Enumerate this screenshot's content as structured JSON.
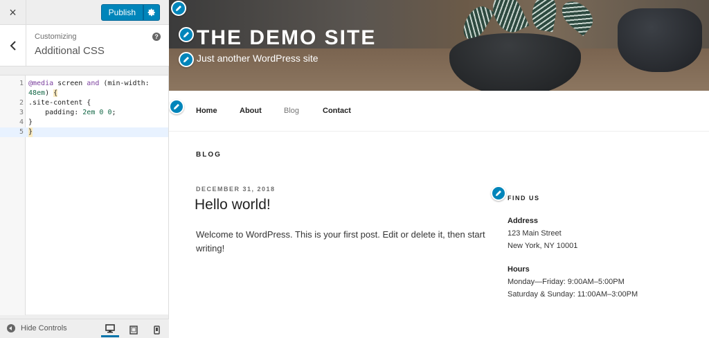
{
  "customizer": {
    "close_label": "×",
    "publish_label": "Publish",
    "customizing_label": "Customizing",
    "section_title": "Additional CSS",
    "help_label": "?",
    "hide_controls_label": "Hide Controls",
    "code": [
      {
        "line": "1",
        "text": "@media screen and (min-width:"
      },
      {
        "line": "",
        "text": "48em) {"
      },
      {
        "line": "2",
        "text": ".site-content {"
      },
      {
        "line": "3",
        "text": "    padding: 2em 0 0;"
      },
      {
        "line": "4",
        "text": "}"
      },
      {
        "line": "5",
        "text": "}"
      }
    ],
    "accent_color": "#0085ba"
  },
  "site": {
    "title": "THE DEMO SITE",
    "tagline": "Just another WordPress site",
    "nav": [
      "Home",
      "About",
      "Blog",
      "Contact"
    ],
    "current_nav": "Blog",
    "page_heading": "BLOG",
    "post": {
      "date": "DECEMBER 31, 2018",
      "title": "Hello world!",
      "body": "Welcome to WordPress. This is your first post. Edit or delete it, then start writing!"
    },
    "widget": {
      "title": "FIND US",
      "address_label": "Address",
      "address_line1": "123 Main Street",
      "address_line2": "New York, NY 10001",
      "hours_label": "Hours",
      "hours_line1": "Monday—Friday: 9:00AM–5:00PM",
      "hours_line2": "Saturday & Sunday: 11:00AM–3:00PM"
    }
  },
  "icons": {
    "edit": "pencil-icon",
    "back": "chevron-left-icon",
    "settings": "gear-icon",
    "devices": [
      "desktop-icon",
      "tablet-icon",
      "mobile-icon"
    ]
  }
}
